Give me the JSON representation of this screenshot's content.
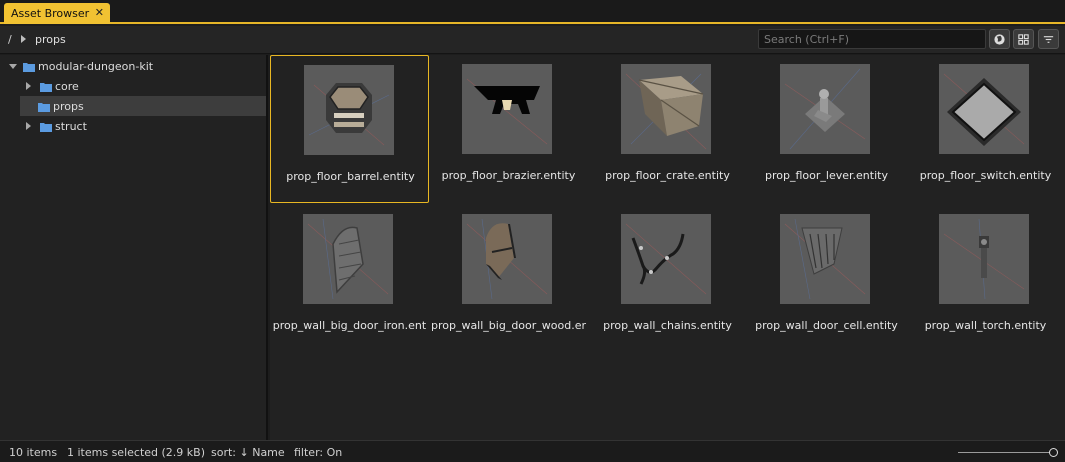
{
  "tab": {
    "title": "Asset Browser",
    "close_glyph": "✕"
  },
  "pathbar": {
    "root": "/",
    "segment": "props",
    "search_placeholder": "Search (Ctrl+F)",
    "buttons": [
      "globe-icon",
      "grid-view-icon",
      "filter-icon"
    ]
  },
  "tree": {
    "root": "modular-dungeon-kit",
    "children": [
      {
        "label": "core",
        "expandable": true,
        "selected": false
      },
      {
        "label": "props",
        "expandable": false,
        "selected": true
      },
      {
        "label": "struct",
        "expandable": true,
        "selected": false
      }
    ]
  },
  "assets": [
    {
      "name": "prop_floor_barrel.entity",
      "selected": true,
      "thumb": "barrel"
    },
    {
      "name": "prop_floor_brazier.entity",
      "selected": false,
      "thumb": "brazier"
    },
    {
      "name": "prop_floor_crate.entity",
      "selected": false,
      "thumb": "crate"
    },
    {
      "name": "prop_floor_lever.entity",
      "selected": false,
      "thumb": "lever"
    },
    {
      "name": "prop_floor_switch.entity",
      "selected": false,
      "thumb": "switch"
    },
    {
      "name": "prop_wall_big_door_iron.ent",
      "selected": false,
      "thumb": "door-iron"
    },
    {
      "name": "prop_wall_big_door_wood.er",
      "selected": false,
      "thumb": "door-wood"
    },
    {
      "name": "prop_wall_chains.entity",
      "selected": false,
      "thumb": "chains"
    },
    {
      "name": "prop_wall_door_cell.entity",
      "selected": false,
      "thumb": "door-cell"
    },
    {
      "name": "prop_wall_torch.entity",
      "selected": false,
      "thumb": "torch"
    }
  ],
  "status": {
    "count": "10 items",
    "selection": "1 items selected (2.9 kB)",
    "sort": "sort: ↓ Name",
    "filter": "filter: On"
  },
  "colors": {
    "accent": "#f1c232",
    "folder": "#4a90d9",
    "panel": "#222222"
  }
}
